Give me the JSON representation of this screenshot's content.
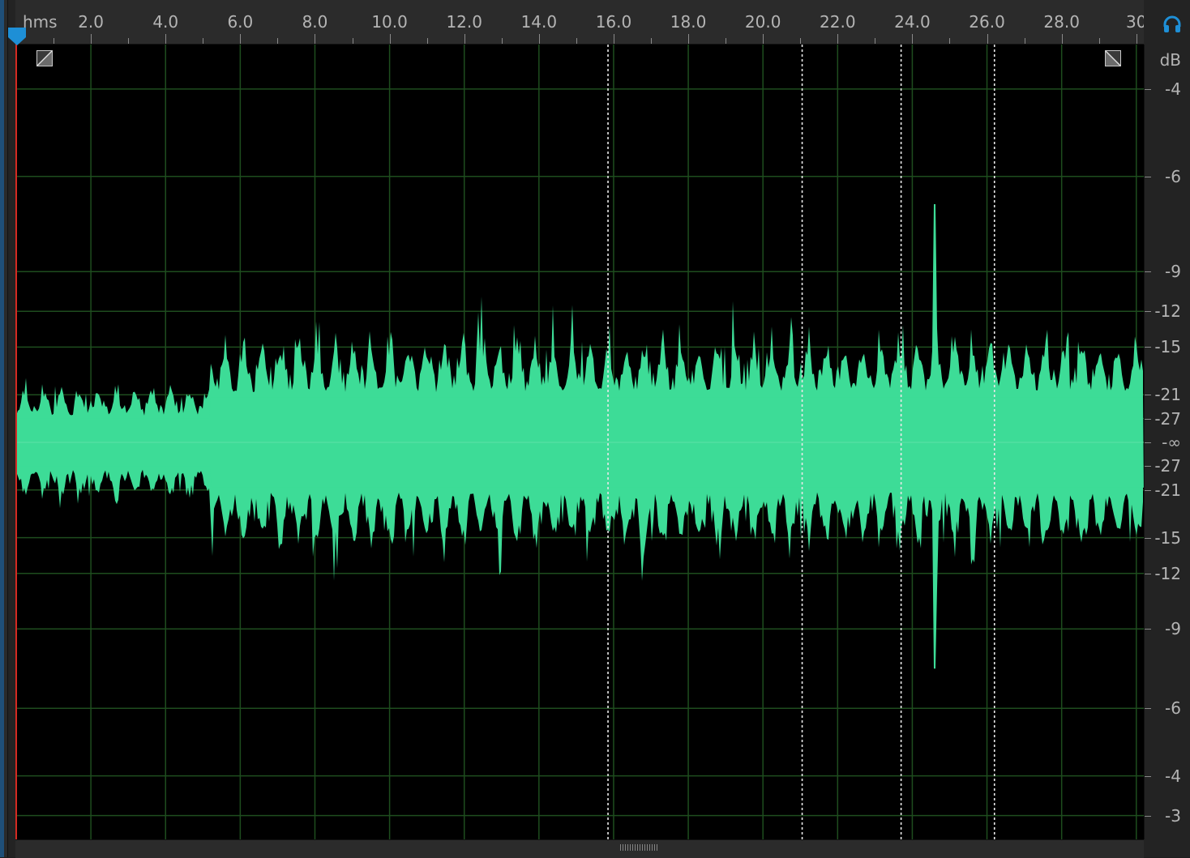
{
  "ruler": {
    "unit": "hms",
    "ticks": [
      "2.0",
      "4.0",
      "6.0",
      "8.0",
      "10.0",
      "12.0",
      "14.0",
      "16.0",
      "18.0",
      "20.0",
      "22.0",
      "24.0",
      "26.0",
      "28.0",
      "30"
    ],
    "visible_end_seconds": 30.2
  },
  "db_scale": {
    "header": "dB",
    "labels": [
      {
        "text": "-4",
        "amp": 0.89
      },
      {
        "text": "-6",
        "amp": 0.67
      },
      {
        "text": "-9",
        "amp": 0.43
      },
      {
        "text": "-12",
        "amp": 0.33
      },
      {
        "text": "-15",
        "amp": 0.24
      },
      {
        "text": "-21",
        "amp": 0.12
      },
      {
        "text": "-27",
        "amp": 0.06
      },
      {
        "text": "-∞",
        "amp": 0
      },
      {
        "text": "-27",
        "amp": -0.06
      },
      {
        "text": "-21",
        "amp": -0.12
      },
      {
        "text": "-15",
        "amp": -0.24
      },
      {
        "text": "-12",
        "amp": -0.33
      },
      {
        "text": "-9",
        "amp": -0.47
      },
      {
        "text": "-6",
        "amp": -0.67
      },
      {
        "text": "-4",
        "amp": -0.84
      },
      {
        "text": "-3",
        "amp": -0.94
      }
    ]
  },
  "markers_seconds": [
    15.85,
    21.05,
    23.7,
    26.2
  ],
  "playhead_seconds": 0,
  "waveform": {
    "color": "#3ddc97",
    "segments": [
      {
        "from_s": 0.0,
        "to_s": 5.2,
        "peak_amp": 0.16
      },
      {
        "from_s": 5.2,
        "to_s": 30.2,
        "peak_amp": 0.3
      }
    ],
    "notable_peak": {
      "at_s": 24.6,
      "amp": 0.6
    }
  },
  "colors": {
    "background": "#000000",
    "grid": "#1e4d1e",
    "playhead": "#d42a22",
    "accent": "#1e8fd6",
    "marker": "#e8e8e8"
  },
  "icons": {
    "monitor": "headphones-icon",
    "fade_in": "fade-in-handle",
    "fade_out": "fade-out-handle",
    "scroll": "scroll-grip"
  }
}
